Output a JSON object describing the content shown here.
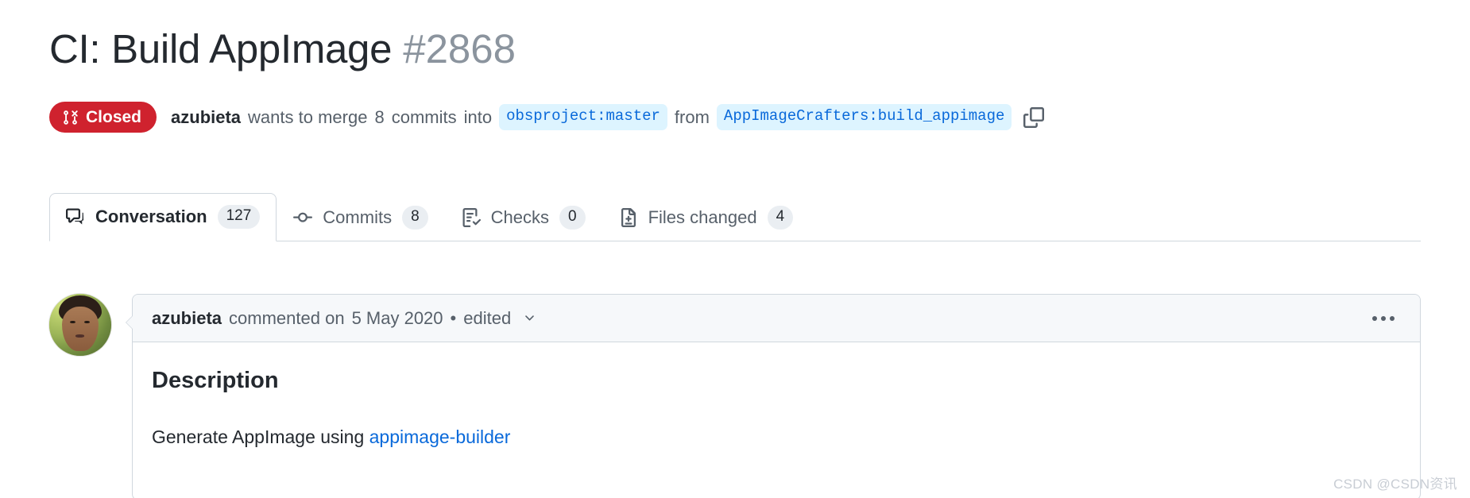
{
  "header": {
    "title": "CI: Build AppImage",
    "number": "#2868"
  },
  "state": {
    "label": "Closed",
    "color": "#cf222e",
    "icon": "git-pull-request-closed-icon"
  },
  "merge_info": {
    "author": "azubieta",
    "wants_text": "wants to merge",
    "commits_count": "8",
    "commits_word": "commits",
    "into_word": "into",
    "base_branch": "obsproject:master",
    "from_word": "from",
    "head_branch": "AppImageCrafters:build_appimage",
    "copy_icon": "copy-icon",
    "branch_chip_bg": "#ddf4ff",
    "branch_chip_fg": "#0969da"
  },
  "tabs": [
    {
      "label": "Conversation",
      "count": "127",
      "icon": "comment-discussion-icon",
      "selected": true
    },
    {
      "label": "Commits",
      "count": "8",
      "icon": "git-commit-icon",
      "selected": false
    },
    {
      "label": "Checks",
      "count": "0",
      "icon": "checklist-icon",
      "selected": false
    },
    {
      "label": "Files changed",
      "count": "4",
      "icon": "file-diff-icon",
      "selected": false
    }
  ],
  "comment": {
    "avatar_name": "azubieta",
    "author": "azubieta",
    "action_text": "commented on",
    "date": "5 May 2020",
    "separator": "•",
    "edited_label": "edited",
    "caret_icon": "chevron-down-icon",
    "menu_icon": "kebab-horizontal-icon",
    "body": {
      "heading": "Description",
      "paragraph_before_link": "Generate AppImage using ",
      "link_text": "appimage-builder",
      "link_color": "#0969da"
    }
  },
  "watermark": {
    "text": "CSDN @CSDN资讯"
  }
}
